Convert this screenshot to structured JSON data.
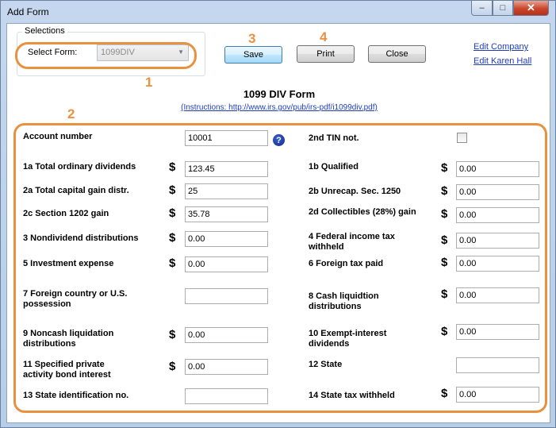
{
  "window": {
    "title": "Add Form",
    "min": "–",
    "max": "□",
    "close": "✕"
  },
  "selections": {
    "legend": "Selections",
    "label": "Select Form:",
    "value": "1099DIV",
    "caret": "▼"
  },
  "annotations": [
    "1",
    "2",
    "3",
    "4"
  ],
  "buttons": {
    "save": "Save",
    "print": "Print",
    "close": "Close"
  },
  "links": {
    "edit_company": "Edit Company",
    "edit_user": "Edit Karen Hall"
  },
  "form": {
    "title": "1099 DIV Form",
    "instructions": "(Instructions: http://www.irs.gov/pub/irs-pdf/i1099div.pdf)"
  },
  "dollar": "$",
  "help_glyph": "?",
  "fields": {
    "account_number": {
      "label": "Account number",
      "value": "10001"
    },
    "tin_not": {
      "label": "2nd TIN not."
    },
    "f1a": {
      "label": "1a Total ordinary dividends",
      "value": "123.45"
    },
    "f1b": {
      "label": "1b Qualified",
      "value": "0.00"
    },
    "f2a": {
      "label": "2a Total capital gain distr.",
      "value": "25"
    },
    "f2b": {
      "label": "2b Unrecap. Sec. 1250",
      "value": "0.00"
    },
    "f2c": {
      "label": "2c Section 1202 gain",
      "value": "35.78"
    },
    "f2d": {
      "label": "2d Collectibles (28%) gain",
      "value": "0.00"
    },
    "f3": {
      "label": "3 Nondividend distributions",
      "value": "0.00"
    },
    "f4": {
      "label_l1": "4 Federal income tax",
      "label_l2": "withheld",
      "value": "0.00"
    },
    "f5": {
      "label": "5 Investment expense",
      "value": "0.00"
    },
    "f6": {
      "label": "6 Foreign tax paid",
      "value": "0.00"
    },
    "f7": {
      "label_l1": "7 Foreign country or U.S.",
      "label_l2": "possession",
      "value": ""
    },
    "f8": {
      "label_l1": "8 Cash liquidtion",
      "label_l2": "distributions",
      "value": "0.00"
    },
    "f9": {
      "label_l1": "9 Noncash liquidation",
      "label_l2": "distributions",
      "value": "0.00"
    },
    "f10": {
      "label_l1": "10 Exempt-interest",
      "label_l2": "dividends",
      "value": "0.00"
    },
    "f11": {
      "label_l1": "11 Specified private",
      "label_l2": "activity bond interest",
      "value": "0.00"
    },
    "f12": {
      "label": "12 State",
      "value": ""
    },
    "f13": {
      "label": "13 State identification no.",
      "value": ""
    },
    "f14": {
      "label": "14 State tax withheld",
      "value": "0.00"
    }
  },
  "colors": {
    "highlight": "#e8913f",
    "link": "#1f3dba",
    "window_frame": "#b7cde8"
  }
}
